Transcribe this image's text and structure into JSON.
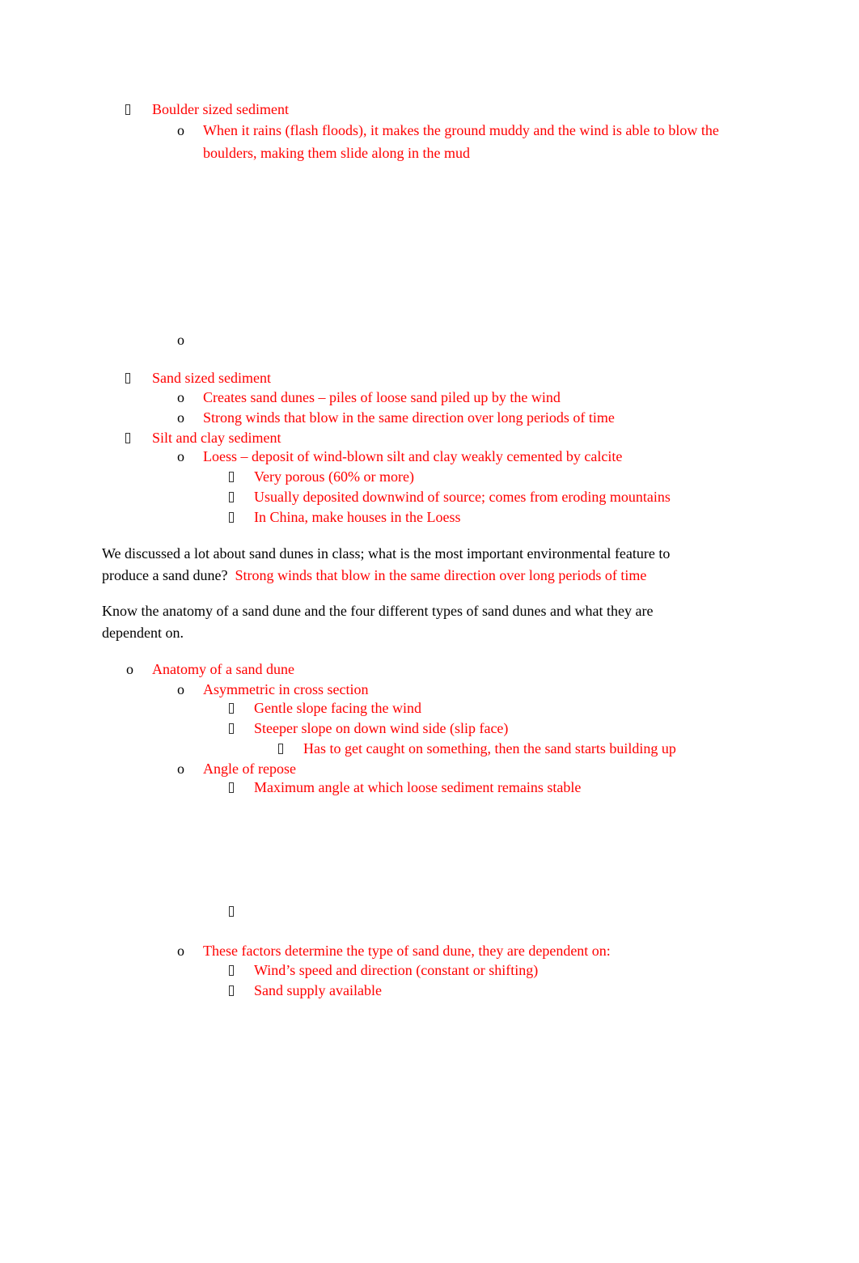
{
  "colors": {
    "answer": "#ff0000",
    "text": "#000000"
  },
  "items": [
    {
      "level": 1,
      "marker": "box",
      "lines": [
        "Boulder sized sediment"
      ]
    },
    {
      "level": 2,
      "marker": "o",
      "lines": [
        "When it rains (flash floods), it makes the ground muddy and the wind is able to blow the",
        "boulders, making them slide along in the mud"
      ]
    },
    {
      "level": 2,
      "marker": "o",
      "lines": [
        ""
      ]
    },
    {
      "level": 1,
      "marker": "box",
      "lines": [
        "Sand sized sediment"
      ]
    },
    {
      "level": 2,
      "marker": "o",
      "lines": [
        "Creates sand dunes – piles of loose sand piled up by the wind"
      ]
    },
    {
      "level": 2,
      "marker": "o",
      "lines": [
        "Strong winds that blow in the same direction over long periods of time"
      ]
    },
    {
      "level": 1,
      "marker": "box",
      "lines": [
        "Silt and clay sediment"
      ]
    },
    {
      "level": 2,
      "marker": "o",
      "lines": [
        "Loess – deposit of wind-blown silt and clay weakly cemented by calcite"
      ]
    },
    {
      "level": 3,
      "marker": "box",
      "lines": [
        "Very porous (60% or more)"
      ]
    },
    {
      "level": 3,
      "marker": "box",
      "lines": [
        "Usually deposited downwind of source; comes from eroding mountains"
      ]
    },
    {
      "level": 3,
      "marker": "box",
      "lines": [
        "In China, make houses in the Loess"
      ]
    },
    {
      "level": 1,
      "marker": "o",
      "lines": [
        "Anatomy of a sand dune"
      ]
    },
    {
      "level": 2,
      "marker": "o",
      "lines": [
        "Asymmetric in cross section"
      ]
    },
    {
      "level": 3,
      "marker": "box",
      "lines": [
        "Gentle slope facing the wind"
      ]
    },
    {
      "level": 3,
      "marker": "box",
      "lines": [
        "Steeper slope on down wind side (slip face)"
      ]
    },
    {
      "level": 4,
      "marker": "box",
      "lines": [
        "Has to get caught on something, then the sand starts building up"
      ]
    },
    {
      "level": 2,
      "marker": "o",
      "lines": [
        "Angle of repose"
      ]
    },
    {
      "level": 3,
      "marker": "box",
      "lines": [
        "Maximum angle at which loose sediment remains stable"
      ]
    },
    {
      "level": 3,
      "marker": "box",
      "lines": [
        ""
      ]
    },
    {
      "level": 2,
      "marker": "o",
      "lines": [
        "These factors determine the type of sand dune, they are dependent on:"
      ]
    },
    {
      "level": 3,
      "marker": "box",
      "lines": [
        "Wind’s speed and direction (constant or shifting)"
      ]
    },
    {
      "level": 3,
      "marker": "box",
      "lines": [
        "Sand supply available"
      ]
    }
  ],
  "question1": {
    "line1": "We discussed a lot about sand dunes in class; what is the most important environmental feature to",
    "line2": "produce a sand dune?",
    "answer": "Strong winds that blow in the same direction over long periods of time"
  },
  "question2": {
    "line1": "Know the anatomy of a sand dune and the four different types of sand dunes and what they are",
    "line2": "dependent on."
  }
}
